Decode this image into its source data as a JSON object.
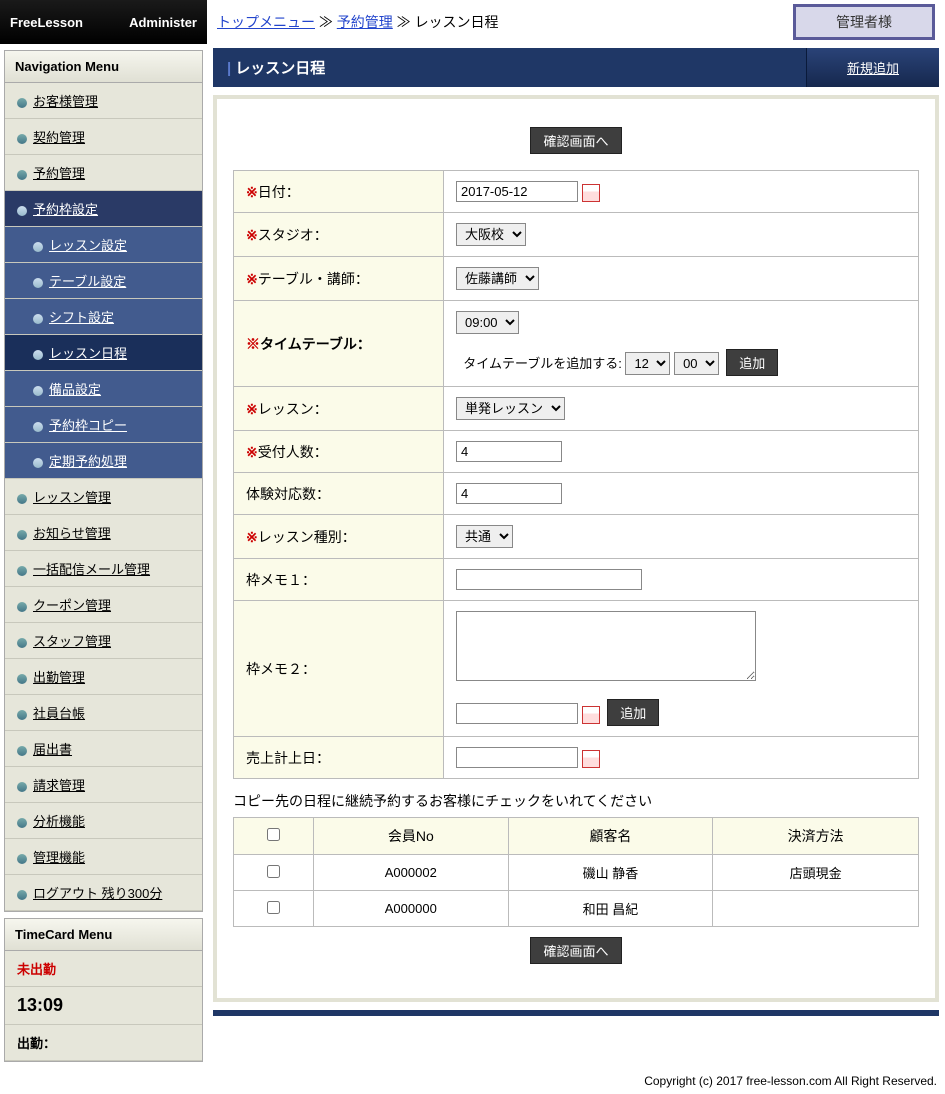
{
  "header": {
    "logo_left": "FreeLesson",
    "logo_right": "Administer",
    "admin_badge": "管理者様"
  },
  "breadcrumb": {
    "top": "トップメニュー",
    "sep": " ≫ ",
    "l1": "予約管理",
    "l2": "レッスン日程"
  },
  "nav": {
    "title": "Navigation Menu",
    "items": {
      "customer": "お客様管理",
      "contract": "契約管理",
      "reserve": "予約管理",
      "slot": "予約枠設定",
      "lessonmgr": "レッスン管理",
      "news": "お知らせ管理",
      "mail": "一括配信メール管理",
      "coupon": "クーポン管理",
      "staff": "スタッフ管理",
      "attend": "出勤管理",
      "ledger": "社員台帳",
      "report": "届出書",
      "bill": "請求管理",
      "analysis": "分析機能",
      "admin": "管理機能",
      "logout": "ログアウト",
      "remain": " 残り300分"
    },
    "sub": {
      "lesson_set": "レッスン設定",
      "table_set": "テーブル設定",
      "shift_set": "シフト設定",
      "schedule": "レッスン日程",
      "note_set": "備品設定",
      "slot_copy": "予約枠コピー",
      "recurring": "定期予約処理"
    }
  },
  "timecard": {
    "title": "TimeCard Menu",
    "status": "未出勤",
    "time": "13:09",
    "label": "出勤："
  },
  "page": {
    "title": "レッスン日程",
    "newbtn": "新規追加",
    "confirm_btn": "確認画面へ"
  },
  "form": {
    "date_label": "日付：",
    "date_val": "2017-05-12",
    "studio_label": "スタジオ：",
    "studio_val": "大阪校",
    "teacher_label": "テーブル・講師：",
    "teacher_val": "佐藤講師",
    "tt_label": "タイムテーブル：",
    "tt_time": "09:00",
    "tt_add_text": "タイムテーブルを追加する:",
    "tt_hh": "12",
    "tt_mm": "00",
    "tt_addbtn": "追加",
    "lesson_label": "レッスン：",
    "lesson_val": "単発レッスン",
    "cap_label": "受付人数：",
    "cap_val": "4",
    "trial_label": "体験対応数：",
    "trial_val": "4",
    "type_label": "レッスン種別：",
    "type_val": "共通",
    "memo1_label": "枠メモ１：",
    "memo2_label": "枠メモ２：",
    "memo2_addbtn": "追加",
    "sales_label": "売上計上日："
  },
  "custnote": "コピー先の日程に継続予約するお客様にチェックをいれてください",
  "cust": {
    "h_no": "会員No",
    "h_name": "顧客名",
    "h_pay": "決済方法",
    "rows": [
      {
        "no": "A000002",
        "name": "磯山 静香",
        "pay": "店頭現金"
      },
      {
        "no": "A000000",
        "name": "和田 昌紀",
        "pay": ""
      }
    ]
  },
  "footer": "Copyright (c) 2017 free-lesson.com All Right Reserved."
}
